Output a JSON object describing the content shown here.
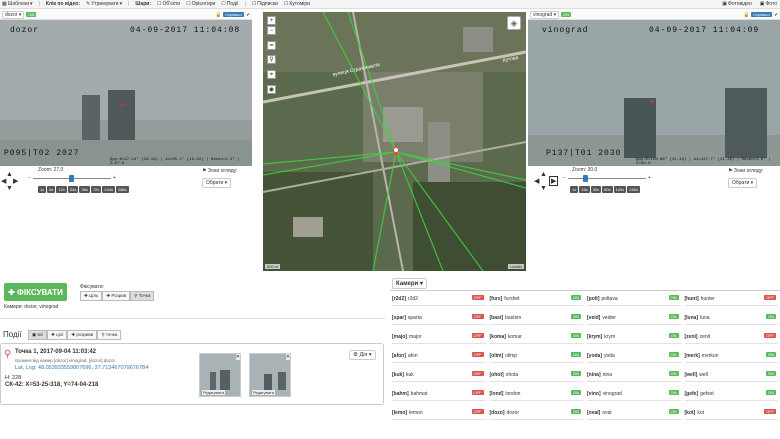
{
  "topbar": {
    "template_label": "Шаблони",
    "click_video_label": "Клік по відео:",
    "click_video_value": "Утримувати",
    "layers_label": "Шари:",
    "layers": [
      "Об'єкти",
      "Орієнтири",
      "Події"
    ],
    "right_items": [
      "Підписки",
      "Кутоміри"
    ],
    "far_right": [
      "Фотовідео",
      "Фото"
    ]
  },
  "left_cam": {
    "name": "dozor",
    "state": "ON",
    "btn": "Скріншот",
    "osd_name": "dozor",
    "osd_date": "04-09-2017 11:04:08",
    "osd_left": "P095|T02  2027",
    "osd_right": "Дир:K=97.14° (16-19) | Аз=95.1° (16-02) | Нахил=2.3° | Z=27.0",
    "zoom_label": "Zoom: 27.0",
    "zoom_level": 0.5,
    "presets": [
      "1x",
      "6x",
      "12x",
      "24x",
      "36x",
      "72x",
      "144x",
      "288x"
    ],
    "zones_label": "Зони огляду:",
    "select_label": "Обрати"
  },
  "right_cam": {
    "name": "vinograd",
    "state": "ON",
    "btn": "Скріншот",
    "osd_name": "vinograd",
    "osd_date": "04-09-2017 11:04:09",
    "osd_left": "P137|T01  2030",
    "osd_right": "Дир:K=128.66° (21-44) | Аз=127.7° (21-26) | Нахил=1.6° | Z=30.0",
    "zoom_label": "Zoom: 30.0",
    "zoom_level": 0.2,
    "presets": [
      "1x",
      "15x",
      "30x",
      "60x",
      "120x",
      "240x"
    ],
    "zones_label": "Зони огляду:",
    "select_label": "Обрати"
  },
  "map": {
    "street1": "вулиця Стратонавтів",
    "street2": "Кутова",
    "scale": "500 m",
    "attribution": "Leaflet"
  },
  "fix": {
    "button": "ФІКСУВАТИ",
    "focus_label": "Фіксувати:",
    "focus_options": [
      "Ціль",
      "Розрив",
      "Точка"
    ],
    "cameras_line": "Камери: dozor, vinograd"
  },
  "events": {
    "title": "Події",
    "filters": [
      "всі",
      "цілі",
      "розриви",
      "точки"
    ],
    "item": {
      "title": "Точка 1, 2017-09-04 11:03:42",
      "desc": "промені від камер [dozor] vinograd, [dozor] dozor",
      "latlng": "Lat, Lng: 48.053933559807696, 37.7134670796767B4",
      "h": "H: 228",
      "sk": "СК-42: X=53-25-318, Y=74-04-218",
      "action": "Дія",
      "thumb_label": "Редагувати"
    }
  },
  "cameras": {
    "header": "Камери",
    "rows": [
      [
        {
          "id": "[r2d2]",
          "name": "r2d2",
          "st": "OFF"
        },
        {
          "id": "[furs]",
          "name": "furshet",
          "st": "ON"
        },
        {
          "id": "[polt]",
          "name": "poltava",
          "st": "ON"
        },
        {
          "id": "[hunt]",
          "name": "hunter",
          "st": "OFF"
        }
      ],
      [
        {
          "id": "[spar]",
          "name": "sparta",
          "st": "OFF"
        },
        {
          "id": "[bast]",
          "name": "bastion",
          "st": "ON"
        },
        {
          "id": "[veid]",
          "name": "veider",
          "st": "ON"
        },
        {
          "id": "[luna]",
          "name": "luna",
          "st": "ON"
        }
      ],
      [
        {
          "id": "[majo]",
          "name": "major",
          "st": "OFF"
        },
        {
          "id": "[koma]",
          "name": "komar",
          "st": "ON"
        },
        {
          "id": "[krym]",
          "name": "krym",
          "st": "ON"
        },
        {
          "id": "[zeni]",
          "name": "zenit",
          "st": "OFF"
        }
      ],
      [
        {
          "id": "[afon]",
          "name": "afon",
          "st": "OFF"
        },
        {
          "id": "[olim]",
          "name": "olimp",
          "st": "ON"
        },
        {
          "id": "[yoda]",
          "name": "yoda",
          "st": "ON"
        },
        {
          "id": "[merk]",
          "name": "merkun",
          "st": "ON"
        }
      ],
      [
        {
          "id": "[kuk]",
          "name": "kuk",
          "st": "OFF"
        },
        {
          "id": "[ohot]",
          "name": "ohota",
          "st": "ON"
        },
        {
          "id": "[nina]",
          "name": "nina",
          "st": "ON"
        },
        {
          "id": "[well]",
          "name": "well",
          "st": "ON"
        }
      ],
      [
        {
          "id": "[bahm]",
          "name": "bahmat",
          "st": "OFF"
        },
        {
          "id": "[lond]",
          "name": "london",
          "st": "ON"
        },
        {
          "id": "[vino]",
          "name": "vinograd",
          "st": "ON"
        },
        {
          "id": "[gefe]",
          "name": "gefest",
          "st": "ON"
        }
      ],
      [
        {
          "id": "[lemo]",
          "name": "lemon",
          "st": "OFF"
        },
        {
          "id": "[dozo]",
          "name": "dozor",
          "st": "ON"
        },
        {
          "id": "[oval]",
          "name": "oval",
          "st": "ON"
        },
        {
          "id": "[kot]",
          "name": "kot",
          "st": "OFF"
        }
      ]
    ]
  },
  "colors": {
    "on": "#5cb85c",
    "off": "#d9534f",
    "primary": "#337ab7",
    "marker": "#e74c3c",
    "ray": "#3fd13f"
  }
}
